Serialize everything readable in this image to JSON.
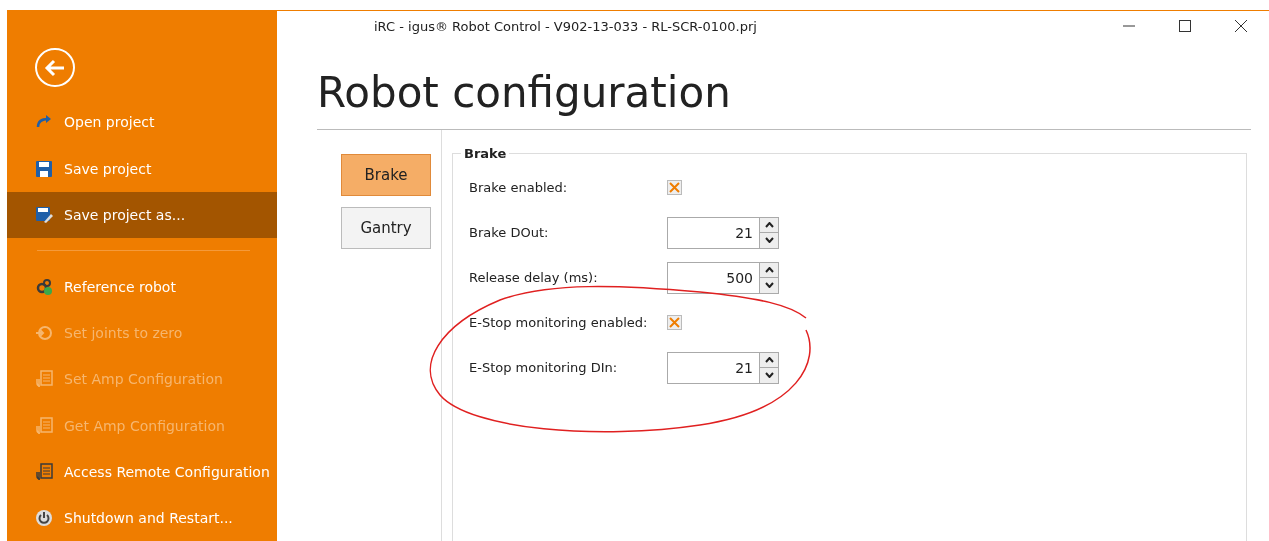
{
  "window": {
    "title": "iRC - igus® Robot Control - V902-13-033 - RL-SCR-0100.prj"
  },
  "sidebar": {
    "items": [
      {
        "label": "Open project",
        "selected": false,
        "disabled": false
      },
      {
        "label": "Save project",
        "selected": false,
        "disabled": false
      },
      {
        "label": "Save project as...",
        "selected": true,
        "disabled": false
      },
      {
        "label": "Reference robot",
        "selected": false,
        "disabled": false
      },
      {
        "label": "Set joints to zero",
        "selected": false,
        "disabled": true
      },
      {
        "label": "Set Amp Configuration",
        "selected": false,
        "disabled": true
      },
      {
        "label": "Get Amp Configuration",
        "selected": false,
        "disabled": true
      },
      {
        "label": "Access Remote Configuration",
        "selected": false,
        "disabled": false
      },
      {
        "label": "Shutdown and Restart...",
        "selected": false,
        "disabled": false
      }
    ]
  },
  "page_title": "Robot configuration",
  "tabs": [
    {
      "label": "Brake",
      "selected": true
    },
    {
      "label": "Gantry",
      "selected": false
    }
  ],
  "group": {
    "title": "Brake",
    "rows": [
      {
        "kind": "checkbox",
        "label": "Brake enabled:",
        "checked": true
      },
      {
        "kind": "spinner",
        "label": "Brake DOut:",
        "value": "21"
      },
      {
        "kind": "spinner",
        "label": "Release delay (ms):",
        "value": "500"
      },
      {
        "kind": "checkbox",
        "label": "E-Stop monitoring enabled:",
        "checked": true
      },
      {
        "kind": "spinner",
        "label": "E-Stop monitoring DIn:",
        "value": "21"
      }
    ]
  }
}
